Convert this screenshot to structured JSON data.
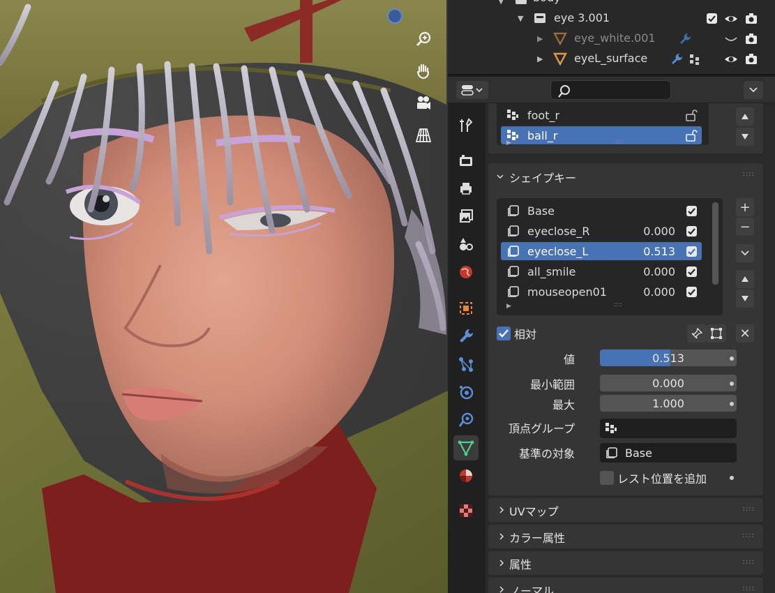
{
  "outliner": {
    "rows": [
      {
        "name": "body"
      },
      {
        "name": "eye 3.001"
      },
      {
        "name": "eye_white.001"
      },
      {
        "name": "eyeL_surface"
      }
    ]
  },
  "bone_list": {
    "items": [
      {
        "name": "foot_r"
      },
      {
        "name": "ball_r"
      }
    ]
  },
  "shape_keys": {
    "title": "シェイプキー",
    "items": [
      {
        "name": "Base",
        "value": ""
      },
      {
        "name": "eyeclose_R",
        "value": "0.000"
      },
      {
        "name": "eyeclose_L",
        "value": "0.513"
      },
      {
        "name": "all_smile",
        "value": "0.000"
      },
      {
        "name": "mouseopen01",
        "value": "0.000"
      }
    ],
    "add_label": "+",
    "remove_label": "−"
  },
  "relative": {
    "label": "相対",
    "close_label": "✕"
  },
  "fields": {
    "value_label": "値",
    "value": "0.513",
    "value_fraction": 0.513,
    "range_min_label": "最小範囲",
    "range_min": "0.000",
    "max_label": "最大",
    "max": "1.000",
    "vertex_group_label": "頂点グループ",
    "relative_to_label": "基準の対象",
    "relative_to": "Base",
    "add_rest_label": "レスト位置を追加"
  },
  "panels": {
    "uv": "UVマップ",
    "color_attr": "カラー属性",
    "attributes": "属性",
    "normals": "ノーマル"
  },
  "colors": {
    "accent": "#4772b3",
    "panel_bg": "#353535",
    "editor_bg": "#2a2a2a"
  }
}
